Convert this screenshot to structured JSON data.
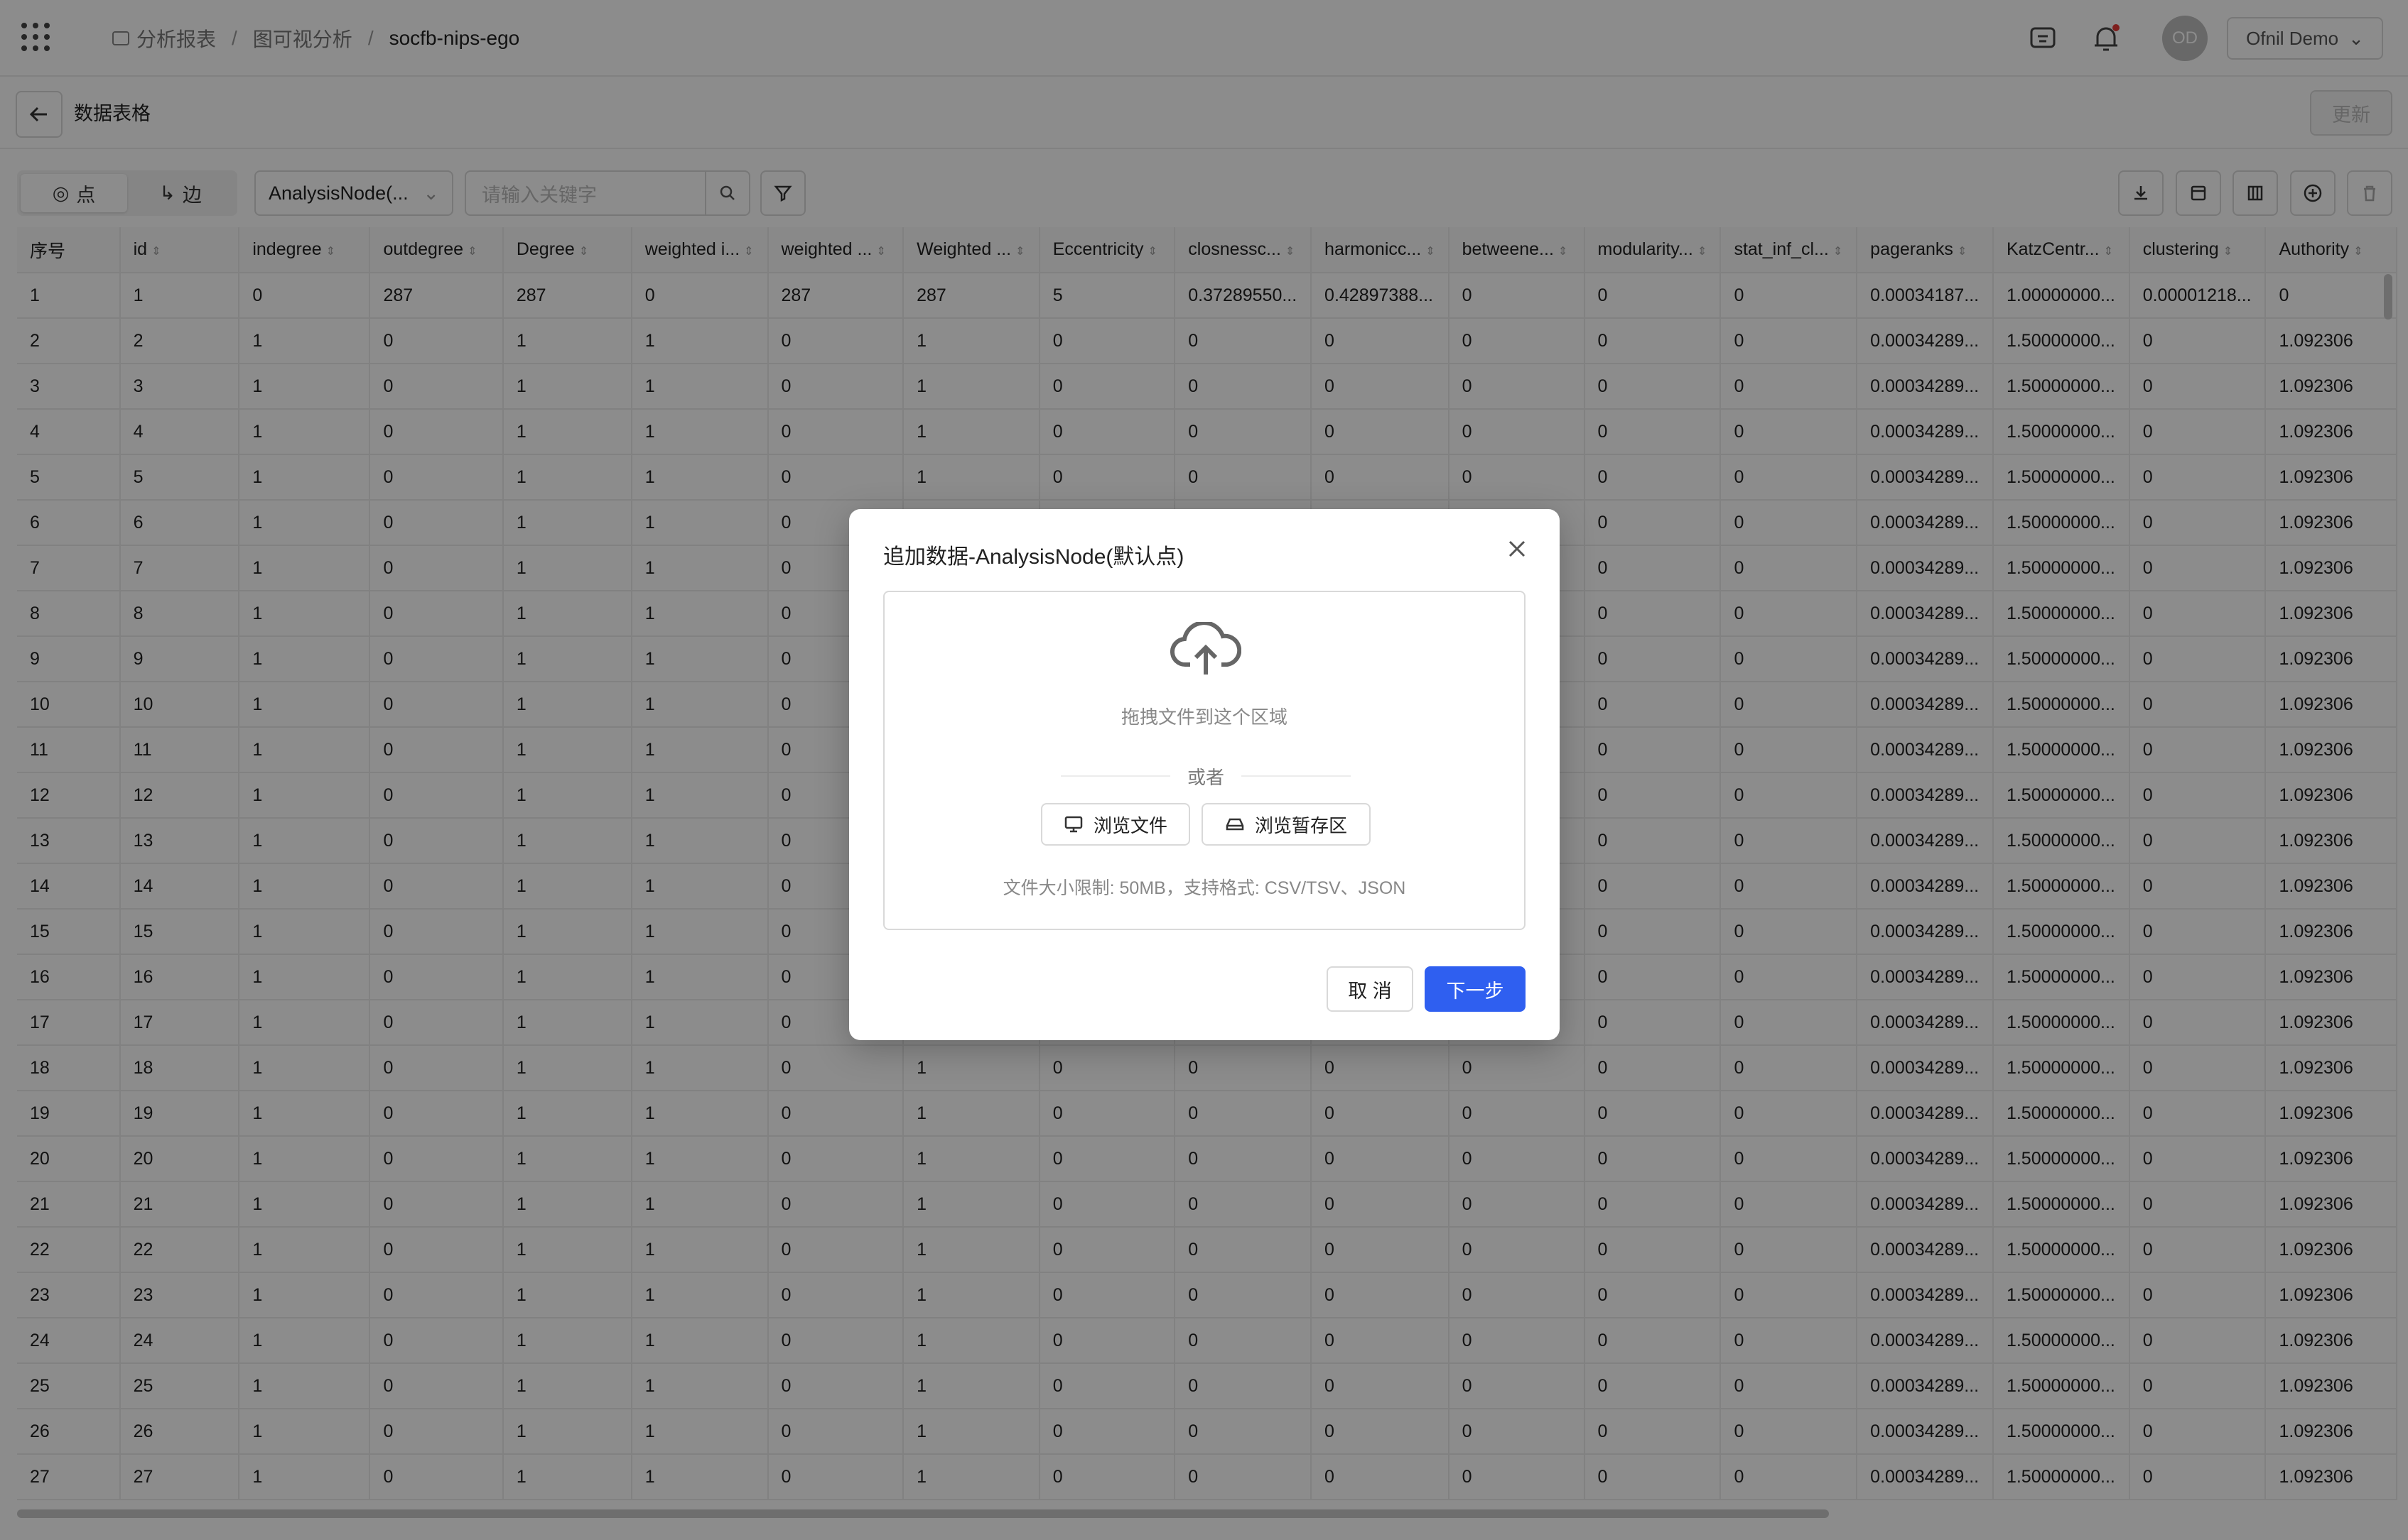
{
  "header": {
    "breadcrumb": [
      "分析报表",
      "图可视分析",
      "socfb-nips-ego"
    ],
    "user_initials": "OD",
    "user_name": "Ofnil Demo"
  },
  "subheader": {
    "title": "数据表格",
    "update_label": "更新"
  },
  "toolbar": {
    "tab_nodes": "点",
    "tab_edges": "边",
    "node_type_select": "AnalysisNode(...",
    "search_placeholder": "请输入关键字"
  },
  "table": {
    "columns": [
      "序号",
      "id",
      "indegree",
      "outdegree",
      "Degree",
      "weighted i...",
      "weighted ...",
      "Weighted ...",
      "Eccentricity",
      "closnessc...",
      "harmonicc...",
      "betweene...",
      "modularity...",
      "stat_inf_cl...",
      "pageranks",
      "KatzCentr...",
      "clustering",
      "Authority"
    ],
    "rows": [
      [
        "1",
        "1",
        "0",
        "287",
        "287",
        "0",
        "287",
        "287",
        "5",
        "0.37289550...",
        "0.42897388...",
        "0",
        "0",
        "0",
        "0.00034187...",
        "1.00000000...",
        "0.00001218...",
        "0"
      ],
      [
        "2",
        "2",
        "1",
        "0",
        "1",
        "1",
        "0",
        "1",
        "0",
        "0",
        "0",
        "0",
        "0",
        "0",
        "0.00034289...",
        "1.50000000...",
        "0",
        "1.092306"
      ],
      [
        "3",
        "3",
        "1",
        "0",
        "1",
        "1",
        "0",
        "1",
        "0",
        "0",
        "0",
        "0",
        "0",
        "0",
        "0.00034289...",
        "1.50000000...",
        "0",
        "1.092306"
      ],
      [
        "4",
        "4",
        "1",
        "0",
        "1",
        "1",
        "0",
        "1",
        "0",
        "0",
        "0",
        "0",
        "0",
        "0",
        "0.00034289...",
        "1.50000000...",
        "0",
        "1.092306"
      ],
      [
        "5",
        "5",
        "1",
        "0",
        "1",
        "1",
        "0",
        "1",
        "0",
        "0",
        "0",
        "0",
        "0",
        "0",
        "0.00034289...",
        "1.50000000...",
        "0",
        "1.092306"
      ],
      [
        "6",
        "6",
        "1",
        "0",
        "1",
        "1",
        "0",
        "",
        "",
        "",
        "",
        "",
        "0",
        "0",
        "0.00034289...",
        "1.50000000...",
        "0",
        "1.092306"
      ],
      [
        "7",
        "7",
        "1",
        "0",
        "1",
        "1",
        "0",
        "",
        "",
        "",
        "",
        "",
        "0",
        "0",
        "0.00034289...",
        "1.50000000...",
        "0",
        "1.092306"
      ],
      [
        "8",
        "8",
        "1",
        "0",
        "1",
        "1",
        "0",
        "",
        "",
        "",
        "",
        "",
        "0",
        "0",
        "0.00034289...",
        "1.50000000...",
        "0",
        "1.092306"
      ],
      [
        "9",
        "9",
        "1",
        "0",
        "1",
        "1",
        "0",
        "",
        "",
        "",
        "",
        "",
        "0",
        "0",
        "0.00034289...",
        "1.50000000...",
        "0",
        "1.092306"
      ],
      [
        "10",
        "10",
        "1",
        "0",
        "1",
        "1",
        "0",
        "",
        "",
        "",
        "",
        "",
        "0",
        "0",
        "0.00034289...",
        "1.50000000...",
        "0",
        "1.092306"
      ],
      [
        "11",
        "11",
        "1",
        "0",
        "1",
        "1",
        "0",
        "",
        "",
        "",
        "",
        "",
        "0",
        "0",
        "0.00034289...",
        "1.50000000...",
        "0",
        "1.092306"
      ],
      [
        "12",
        "12",
        "1",
        "0",
        "1",
        "1",
        "0",
        "",
        "",
        "",
        "",
        "",
        "0",
        "0",
        "0.00034289...",
        "1.50000000...",
        "0",
        "1.092306"
      ],
      [
        "13",
        "13",
        "1",
        "0",
        "1",
        "1",
        "0",
        "",
        "",
        "",
        "",
        "",
        "0",
        "0",
        "0.00034289...",
        "1.50000000...",
        "0",
        "1.092306"
      ],
      [
        "14",
        "14",
        "1",
        "0",
        "1",
        "1",
        "0",
        "",
        "",
        "",
        "",
        "",
        "0",
        "0",
        "0.00034289...",
        "1.50000000...",
        "0",
        "1.092306"
      ],
      [
        "15",
        "15",
        "1",
        "0",
        "1",
        "1",
        "0",
        "",
        "",
        "",
        "",
        "",
        "0",
        "0",
        "0.00034289...",
        "1.50000000...",
        "0",
        "1.092306"
      ],
      [
        "16",
        "16",
        "1",
        "0",
        "1",
        "1",
        "0",
        "",
        "",
        "",
        "",
        "",
        "0",
        "0",
        "0.00034289...",
        "1.50000000...",
        "0",
        "1.092306"
      ],
      [
        "17",
        "17",
        "1",
        "0",
        "1",
        "1",
        "0",
        "",
        "",
        "",
        "",
        "",
        "0",
        "0",
        "0.00034289...",
        "1.50000000...",
        "0",
        "1.092306"
      ],
      [
        "18",
        "18",
        "1",
        "0",
        "1",
        "1",
        "0",
        "1",
        "0",
        "0",
        "0",
        "0",
        "0",
        "0",
        "0.00034289...",
        "1.50000000...",
        "0",
        "1.092306"
      ],
      [
        "19",
        "19",
        "1",
        "0",
        "1",
        "1",
        "0",
        "1",
        "0",
        "0",
        "0",
        "0",
        "0",
        "0",
        "0.00034289...",
        "1.50000000...",
        "0",
        "1.092306"
      ],
      [
        "20",
        "20",
        "1",
        "0",
        "1",
        "1",
        "0",
        "1",
        "0",
        "0",
        "0",
        "0",
        "0",
        "0",
        "0.00034289...",
        "1.50000000...",
        "0",
        "1.092306"
      ],
      [
        "21",
        "21",
        "1",
        "0",
        "1",
        "1",
        "0",
        "1",
        "0",
        "0",
        "0",
        "0",
        "0",
        "0",
        "0.00034289...",
        "1.50000000...",
        "0",
        "1.092306"
      ],
      [
        "22",
        "22",
        "1",
        "0",
        "1",
        "1",
        "0",
        "1",
        "0",
        "0",
        "0",
        "0",
        "0",
        "0",
        "0.00034289...",
        "1.50000000...",
        "0",
        "1.092306"
      ],
      [
        "23",
        "23",
        "1",
        "0",
        "1",
        "1",
        "0",
        "1",
        "0",
        "0",
        "0",
        "0",
        "0",
        "0",
        "0.00034289...",
        "1.50000000...",
        "0",
        "1.092306"
      ],
      [
        "24",
        "24",
        "1",
        "0",
        "1",
        "1",
        "0",
        "1",
        "0",
        "0",
        "0",
        "0",
        "0",
        "0",
        "0.00034289...",
        "1.50000000...",
        "0",
        "1.092306"
      ],
      [
        "25",
        "25",
        "1",
        "0",
        "1",
        "1",
        "0",
        "1",
        "0",
        "0",
        "0",
        "0",
        "0",
        "0",
        "0.00034289...",
        "1.50000000...",
        "0",
        "1.092306"
      ],
      [
        "26",
        "26",
        "1",
        "0",
        "1",
        "1",
        "0",
        "1",
        "0",
        "0",
        "0",
        "0",
        "0",
        "0",
        "0.00034289...",
        "1.50000000...",
        "0",
        "1.092306"
      ],
      [
        "27",
        "27",
        "1",
        "0",
        "1",
        "1",
        "0",
        "1",
        "0",
        "0",
        "0",
        "0",
        "0",
        "0",
        "0.00034289...",
        "1.50000000...",
        "0",
        "1.092306"
      ]
    ]
  },
  "modal": {
    "title": "追加数据-AnalysisNode(默认点)",
    "drop_text": "拖拽文件到这个区域",
    "or_text": "或者",
    "browse_files": "浏览文件",
    "browse_staging": "浏览暂存区",
    "hint": "文件大小限制: 50MB，支持格式: CSV/TSV、JSON",
    "cancel": "取 消",
    "next": "下一步"
  }
}
